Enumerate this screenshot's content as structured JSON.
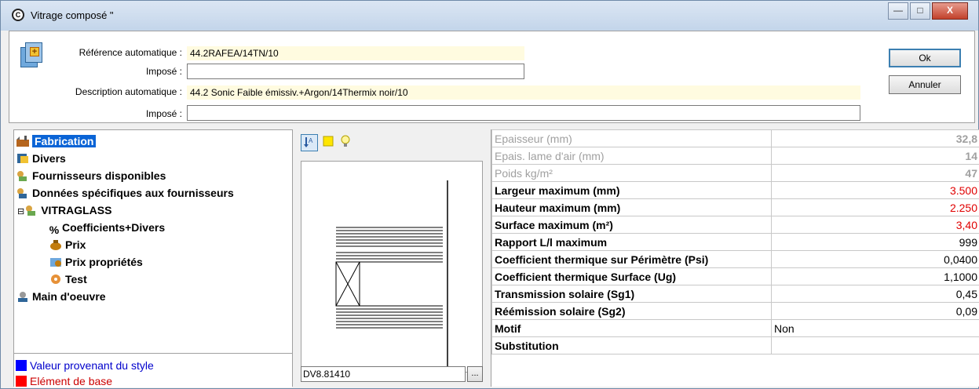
{
  "window": {
    "title": "Vitrage composé \"",
    "icon": "circle-c-icon",
    "controls": {
      "minimize": "—",
      "maximize": "□",
      "close": "X"
    }
  },
  "header": {
    "ref_auto_label": "Référence automatique :",
    "ref_auto_value": "44.2RAFEA/14TN/10",
    "impose_label": "Imposé :",
    "desc_auto_label": "Description automatique :",
    "desc_auto_value": "44.2 Sonic Faible émissiv.+Argon/14Thermix noir/10",
    "impose2_label": "Imposé :"
  },
  "buttons": {
    "ok": "Ok",
    "cancel": "Annuler"
  },
  "tree": {
    "items": [
      {
        "label": "Fabrication",
        "icon": "factory-icon"
      },
      {
        "label": "Divers",
        "icon": "divers-icon"
      },
      {
        "label": "Fournisseurs disponibles",
        "icon": "supplier-icon"
      },
      {
        "label": "Données spécifiques aux fournisseurs",
        "icon": "supplier-data-icon"
      },
      {
        "label": "VITRAGLASS",
        "icon": "vitraglass-icon",
        "expander": "⊟"
      },
      {
        "label": "Coefficients+Divers",
        "icon": "percent-icon"
      },
      {
        "label": "Prix",
        "icon": "money-bag-icon"
      },
      {
        "label": "Prix propriétés",
        "icon": "price-props-icon"
      },
      {
        "label": "Test",
        "icon": "test-icon"
      },
      {
        "label": "Main d'oeuvre",
        "icon": "labour-icon"
      }
    ]
  },
  "legend": {
    "style_label": "Valeur provenant du style",
    "style_color": "#0000ff",
    "base_label": "Elément de base",
    "base_color": "#ff0000"
  },
  "drawing": {
    "code": "DV8.81410",
    "browse": "..."
  },
  "properties": [
    {
      "label": "Epaisseur (mm)",
      "value": "32,8"
    },
    {
      "label": "Epais. lame d'air (mm)",
      "value": "14"
    },
    {
      "label": "Poids kg/m²",
      "value": "47"
    },
    {
      "label": "Largeur maximum (mm)",
      "value": "3.500"
    },
    {
      "label": "Hauteur maximum (mm)",
      "value": "2.250"
    },
    {
      "label": "Surface maximum (m²)",
      "value": "3,40"
    },
    {
      "label": "Rapport L/l maximum",
      "value": "999"
    },
    {
      "label": "Coefficient thermique sur Périmètre (Psi)",
      "value": "0,0400"
    },
    {
      "label": "Coefficient thermique Surface (Ug)",
      "value": "1,1000"
    },
    {
      "label": "Transmission solaire (Sg1)",
      "value": "0,45"
    },
    {
      "label": "Réémission solaire (Sg2)",
      "value": "0,09"
    },
    {
      "label": "Motif",
      "value": "Non"
    },
    {
      "label": "Substitution",
      "value": ""
    }
  ]
}
